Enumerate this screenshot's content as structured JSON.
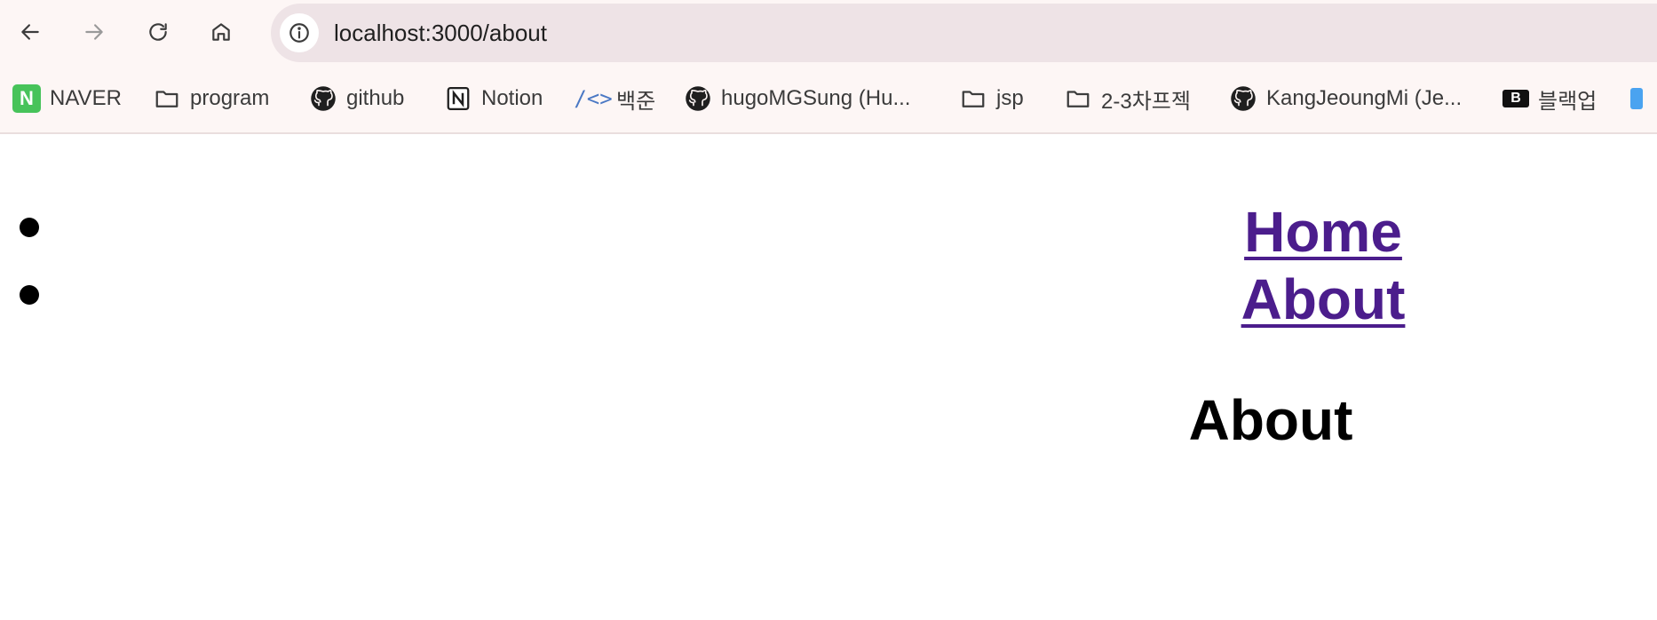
{
  "browser": {
    "url": "localhost:3000/about",
    "bookmarks": [
      {
        "label": "NAVER",
        "icon": "naver-icon"
      },
      {
        "label": "program",
        "icon": "folder-icon"
      },
      {
        "label": "github",
        "icon": "github-icon"
      },
      {
        "label": "Notion",
        "icon": "notion-icon"
      },
      {
        "label": "백준",
        "icon": "code-icon"
      },
      {
        "label": "hugoMGSung (Hu...",
        "icon": "github-icon"
      },
      {
        "label": "jsp",
        "icon": "folder-icon"
      },
      {
        "label": "2-3차프젝",
        "icon": "folder-icon"
      },
      {
        "label": "KangJeoungMi (Je...",
        "icon": "github-icon"
      },
      {
        "label": "블랙업",
        "icon": "blackup-icon"
      }
    ]
  },
  "page": {
    "nav": [
      {
        "label": "Home"
      },
      {
        "label": "About"
      }
    ],
    "title": "About",
    "link_color": "#4b1d8c"
  }
}
